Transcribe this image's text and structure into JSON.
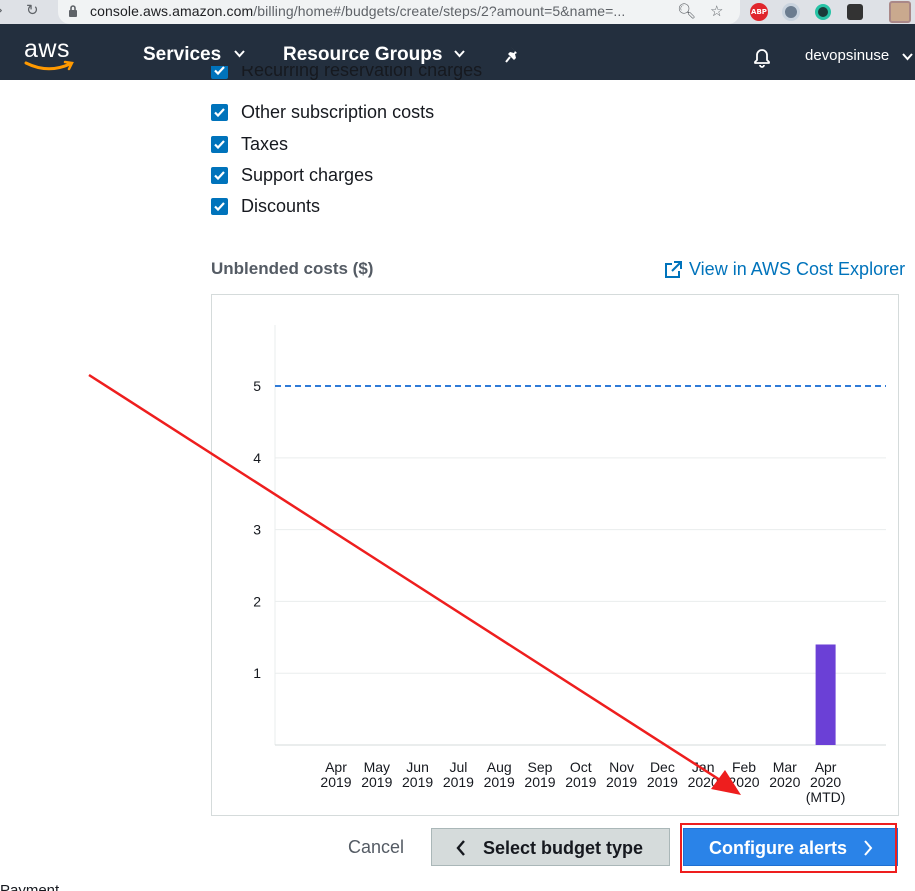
{
  "browser": {
    "url_host": "console.aws.amazon.com",
    "url_path": "/billing/home#/budgets/create/steps/2?amount=5&name=...",
    "extension_badge": "ABP"
  },
  "header": {
    "logo_text": "aws",
    "services_label": "Services",
    "resource_groups_label": "Resource Groups",
    "username": "devopsinuse"
  },
  "options": {
    "clipped_item": "Recurring reservation charges",
    "items": [
      {
        "label": "Other subscription costs",
        "checked": true
      },
      {
        "label": "Taxes",
        "checked": true
      },
      {
        "label": "Support charges",
        "checked": true
      },
      {
        "label": "Discounts",
        "checked": true
      }
    ]
  },
  "cost_section": {
    "title": "Unblended costs ($)",
    "explorer_link": "View in AWS Cost Explorer"
  },
  "chart_data": {
    "type": "bar",
    "categories": [
      [
        "Apr",
        "2019"
      ],
      [
        "May",
        "2019"
      ],
      [
        "Jun",
        "2019"
      ],
      [
        "Jul",
        "2019"
      ],
      [
        "Aug",
        "2019"
      ],
      [
        "Sep",
        "2019"
      ],
      [
        "Oct",
        "2019"
      ],
      [
        "Nov",
        "2019"
      ],
      [
        "Dec",
        "2019"
      ],
      [
        "Jan",
        "2020"
      ],
      [
        "Feb",
        "2020"
      ],
      [
        "Mar",
        "2020"
      ],
      [
        "Apr",
        "2020",
        "(MTD)"
      ]
    ],
    "values": [
      0,
      0,
      0,
      0,
      0,
      0,
      0,
      0,
      0,
      0,
      0,
      0,
      1.4
    ],
    "budget_line": 5,
    "y_ticks": [
      1,
      2,
      3,
      4,
      5
    ],
    "ylim": [
      0,
      5.85
    ],
    "grid": true,
    "bar_color": "#6b40d6",
    "budget_line_color": "#2f7bd8"
  },
  "actions": {
    "cancel_label": "Cancel",
    "prev_label": "Select budget type",
    "next_label": "Configure alerts"
  },
  "footer": {
    "clipped_text": "Payment"
  },
  "colors": {
    "header_bg": "#232f3e",
    "link": "#0073bb",
    "primary_button": "#2a83e8",
    "annotation": "#ee1e1e"
  }
}
